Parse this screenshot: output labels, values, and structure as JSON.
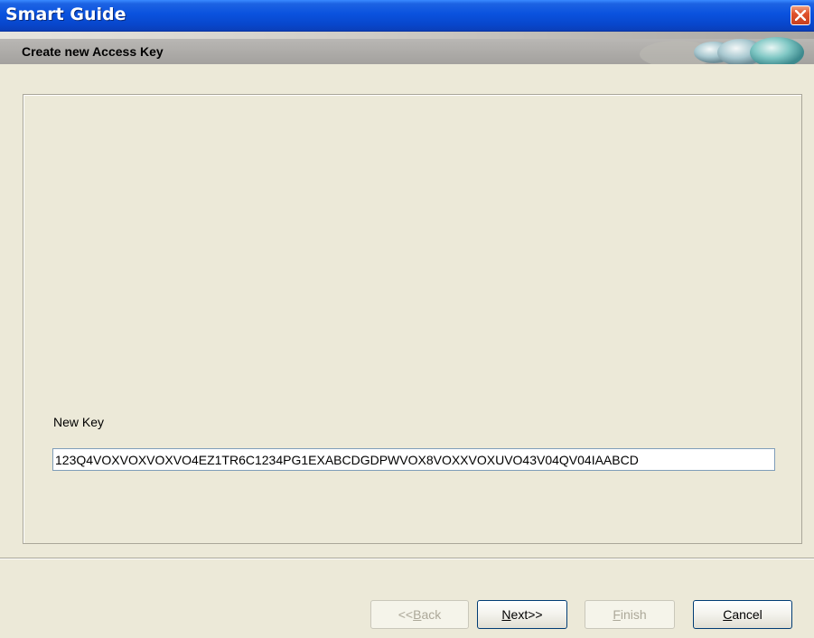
{
  "window": {
    "title": "Smart Guide"
  },
  "header": {
    "subtitle": "Create new Access Key"
  },
  "form": {
    "new_key_label": "New Key",
    "new_key_value": "123Q4VOXVOXVOXVO4EZ1TR6C1234PG1EXABCDGDPWVOX8VOXXVOXUVO43V04QV04IAABCD"
  },
  "buttons": {
    "back": {
      "label_prefix": "<<",
      "label_mnemonic": "B",
      "label_rest": "ack",
      "enabled": false
    },
    "next": {
      "label_mnemonic": "N",
      "label_rest": "ext>>",
      "enabled": true
    },
    "finish": {
      "label_mnemonic": "F",
      "label_rest": "inish",
      "enabled": false
    },
    "cancel": {
      "label_mnemonic": "C",
      "label_rest": "ancel",
      "enabled": true
    }
  },
  "colors": {
    "titlebar": "#0a52de",
    "window_bg": "#ece9d8",
    "close_button": "#e0522c"
  },
  "icons": {
    "close": "close-icon",
    "logo": "bubbles-logo"
  }
}
